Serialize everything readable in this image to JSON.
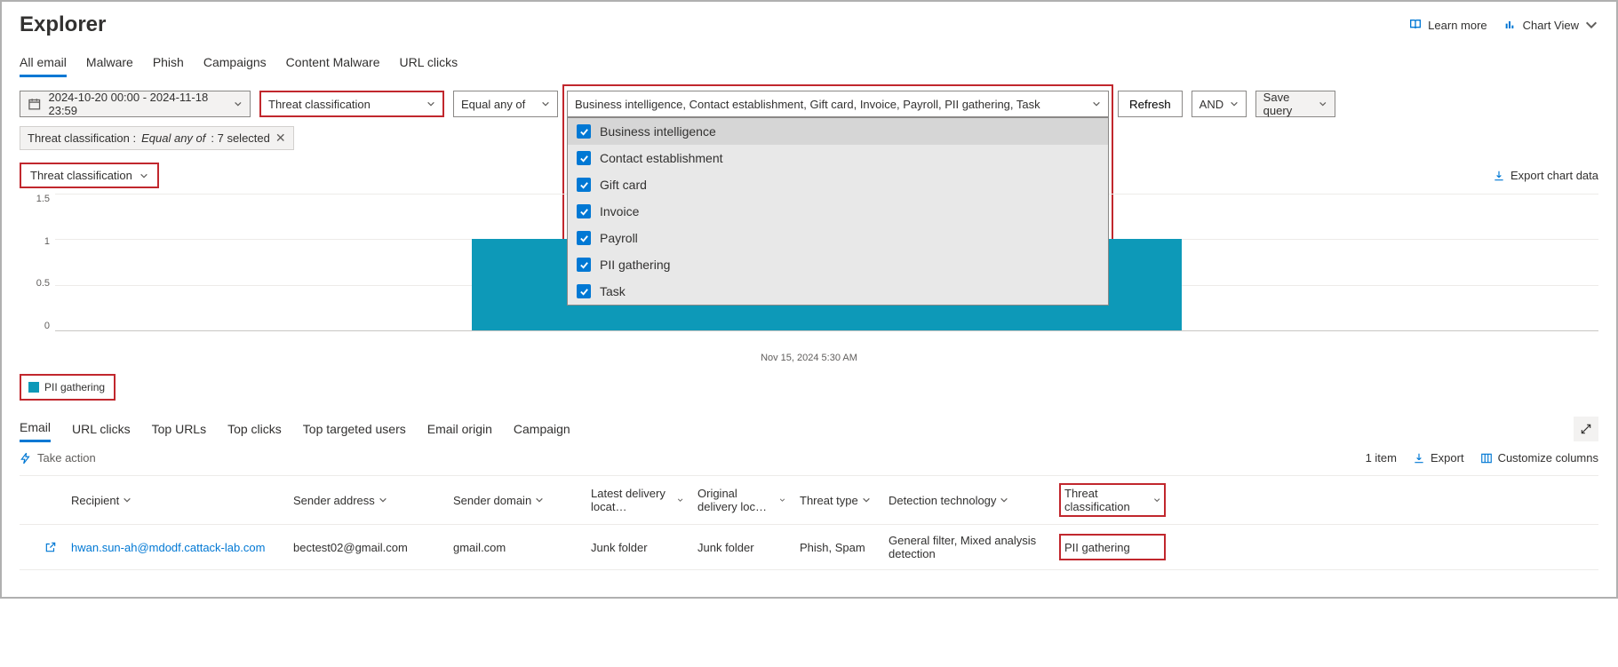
{
  "header": {
    "title": "Explorer",
    "learn_more": "Learn more",
    "chart_view": "Chart View"
  },
  "tabs": [
    "All email",
    "Malware",
    "Phish",
    "Campaigns",
    "Content Malware",
    "URL clicks"
  ],
  "filter": {
    "date_range": "2024-10-20 00:00 - 2024-11-18 23:59",
    "field": "Threat classification",
    "operator": "Equal any of",
    "values_display": "Business intelligence, Contact establishment, Gift card, Invoice, Payroll, PII gathering, Task",
    "refresh": "Refresh",
    "and": "AND",
    "save_query": "Save query"
  },
  "dropdown_options": [
    "Business intelligence",
    "Contact establishment",
    "Gift card",
    "Invoice",
    "Payroll",
    "PII gathering",
    "Task"
  ],
  "pill": {
    "label": "Threat classification :",
    "op": "Equal any of",
    "count": ": 7 selected"
  },
  "chart_controls": {
    "dropdown": "Threat classification",
    "export": "Export chart data"
  },
  "chart_data": {
    "type": "bar",
    "categories": [
      "Nov 15, 2024 5:30 AM"
    ],
    "series": [
      {
        "name": "PII gathering",
        "values": [
          1
        ]
      }
    ],
    "ylabel": "",
    "ylim": [
      0,
      1.5
    ],
    "yticks": [
      0,
      0.5,
      1,
      1.5
    ],
    "legend": "PII gathering"
  },
  "sub_tabs": [
    "Email",
    "URL clicks",
    "Top URLs",
    "Top clicks",
    "Top targeted users",
    "Email origin",
    "Campaign"
  ],
  "actions": {
    "take_action": "Take action",
    "item_count": "1 item",
    "export": "Export",
    "customize": "Customize columns"
  },
  "table": {
    "headers": {
      "recipient": "Recipient",
      "sender_address": "Sender address",
      "sender_domain": "Sender domain",
      "latest_delivery": "Latest delivery locat…",
      "original_delivery": "Original delivery loc…",
      "threat_type": "Threat type",
      "detection_tech": "Detection technology",
      "threat_class": "Threat classification"
    },
    "rows": [
      {
        "recipient": "hwan.sun-ah@mdodf.cattack-lab.com",
        "sender_address": "bectest02@gmail.com",
        "sender_domain": "gmail.com",
        "latest_delivery": "Junk folder",
        "original_delivery": "Junk folder",
        "threat_type": "Phish, Spam",
        "detection_tech": "General filter, Mixed analysis detection",
        "threat_class": "PII gathering"
      }
    ]
  }
}
